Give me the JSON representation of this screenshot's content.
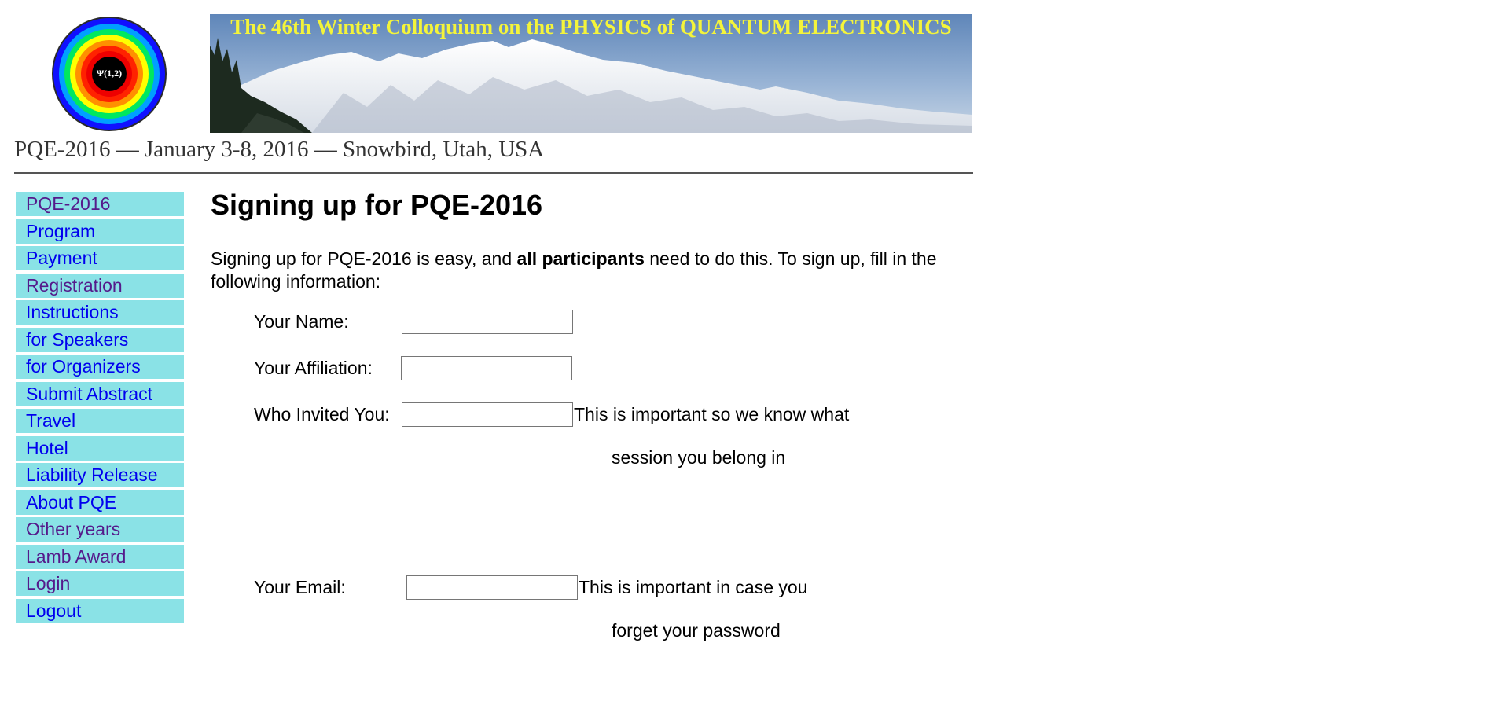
{
  "header": {
    "logo_text": "Ψ(1,2)",
    "banner_title": "The 46th Winter Colloquium on the PHYSICS of QUANTUM ELECTRONICS",
    "subtitle": "PQE-2016 — January 3-8, 2016 — Snowbird, Utah, USA"
  },
  "sidebar": {
    "items": [
      {
        "label": "PQE-2016"
      },
      {
        "label": "Program"
      },
      {
        "label": "Payment"
      },
      {
        "label": "Registration"
      },
      {
        "label": "Instructions"
      },
      {
        "label": "for Speakers"
      },
      {
        "label": "for Organizers"
      },
      {
        "label": "Submit Abstract"
      },
      {
        "label": "Travel"
      },
      {
        "label": "Hotel"
      },
      {
        "label": "Liability Release"
      },
      {
        "label": "About PQE"
      },
      {
        "label": "Other years"
      },
      {
        "label": "Lamb Award"
      },
      {
        "label": "Login"
      },
      {
        "label": "Logout"
      }
    ],
    "bg_color": "#8ae2e6",
    "link_color": "#0000ee",
    "visited_color": "#551a8b"
  },
  "main": {
    "title": "Signing up for PQE-2016",
    "intro": {
      "before": "Signing up for PQE-2016 is easy, and ",
      "bold": "all participants",
      "after": " need to do this. To sign up, fill in the following information:"
    },
    "form": {
      "name_label": "Your Name:",
      "name_value": "",
      "affiliation_label": "Your Affiliation:",
      "affiliation_value": "",
      "invited_label": "Who Invited You:",
      "invited_value": "",
      "invited_note_line1": "This is important so we know what",
      "invited_note_line2": "session you belong in",
      "email_label": "Your Email:",
      "email_value": "",
      "email_note_line1": "This is important in case you",
      "email_note_line2": "forget your password"
    }
  }
}
